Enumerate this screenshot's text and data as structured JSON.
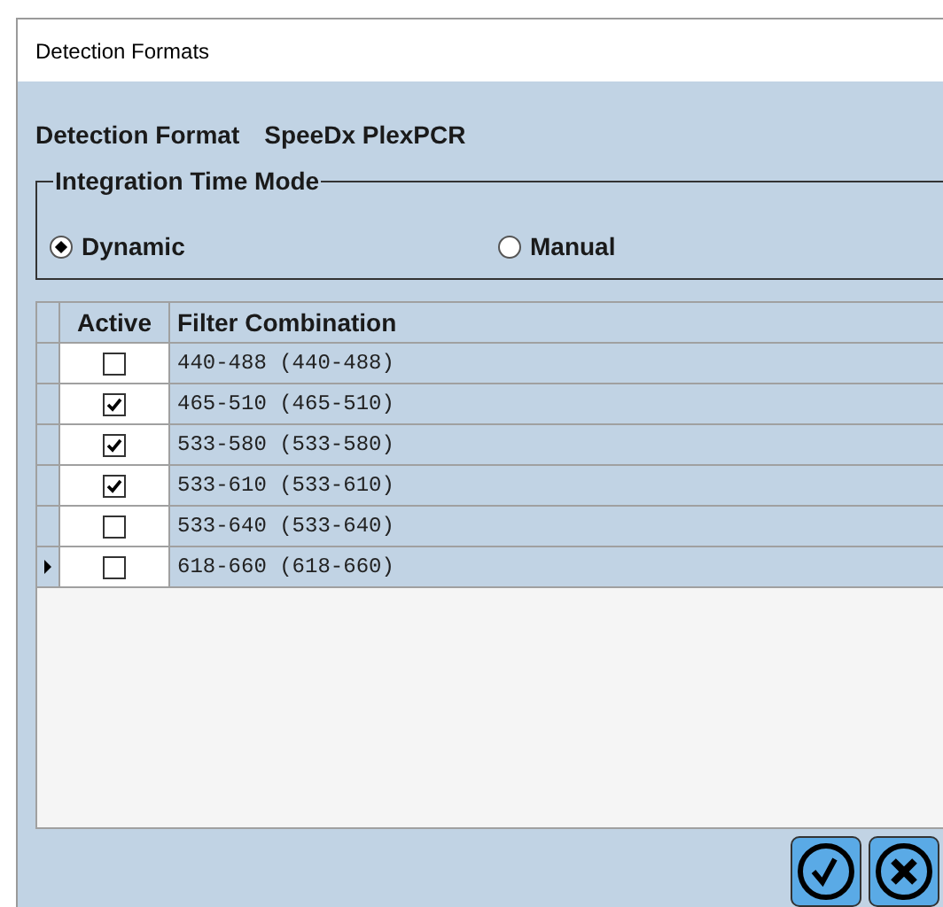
{
  "window": {
    "title": "Detection Formats"
  },
  "detection_format": {
    "label": "Detection Format",
    "value": "SpeeDx PlexPCR"
  },
  "integration_time_mode": {
    "title": "Integration Time Mode",
    "options": [
      {
        "label": "Dynamic",
        "selected": true
      },
      {
        "label": "Manual",
        "selected": false
      }
    ]
  },
  "table": {
    "columns": [
      "Active",
      "Filter Combination"
    ],
    "rows": [
      {
        "active": false,
        "filter": "440-488 (440-488)",
        "current": false
      },
      {
        "active": true,
        "filter": "465-510 (465-510)",
        "current": false
      },
      {
        "active": true,
        "filter": "533-580 (533-580)",
        "current": false
      },
      {
        "active": true,
        "filter": "533-610 (533-610)",
        "current": false
      },
      {
        "active": false,
        "filter": "533-640 (533-640)",
        "current": false
      },
      {
        "active": false,
        "filter": "618-660 (618-660)",
        "current": true
      }
    ]
  }
}
